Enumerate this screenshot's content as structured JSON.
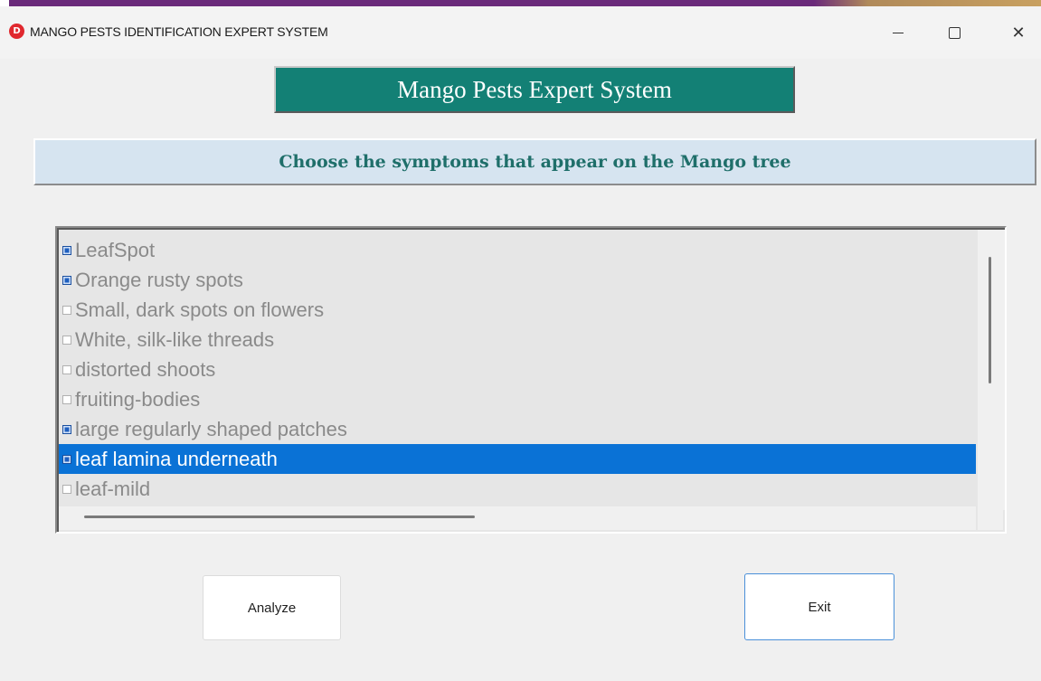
{
  "window": {
    "app_icon_letter": "D",
    "title": "MANGO PESTS IDENTIFICATION EXPERT SYSTEM",
    "controls": {
      "minimize": "minimize",
      "maximize": "maximize",
      "close": "✕"
    }
  },
  "header": {
    "title": "Mango Pests Expert System"
  },
  "instruction": {
    "text": "Choose the symptoms that appear on the Mango tree"
  },
  "symptoms": [
    {
      "label": "LeafSpot",
      "checked": true,
      "selected": false
    },
    {
      "label": "Orange rusty spots",
      "checked": true,
      "selected": false
    },
    {
      "label": "Small, dark spots on flowers",
      "checked": false,
      "selected": false
    },
    {
      "label": "White, silk-like threads",
      "checked": false,
      "selected": false
    },
    {
      "label": "distorted shoots",
      "checked": false,
      "selected": false
    },
    {
      "label": "fruiting-bodies",
      "checked": false,
      "selected": false
    },
    {
      "label": "large regularly shaped patches",
      "checked": true,
      "selected": false
    },
    {
      "label": "leaf lamina underneath",
      "checked": true,
      "selected": true
    },
    {
      "label": "leaf-mild",
      "checked": false,
      "selected": false
    }
  ],
  "buttons": {
    "analyze": "Analyze",
    "exit": "Exit"
  },
  "colors": {
    "banner": "#138075",
    "instruction_bg": "#d6e4f0",
    "instruction_text": "#1f6f6a",
    "selection": "#0a72d6",
    "checkbox_checked": "#1f5fbf"
  }
}
